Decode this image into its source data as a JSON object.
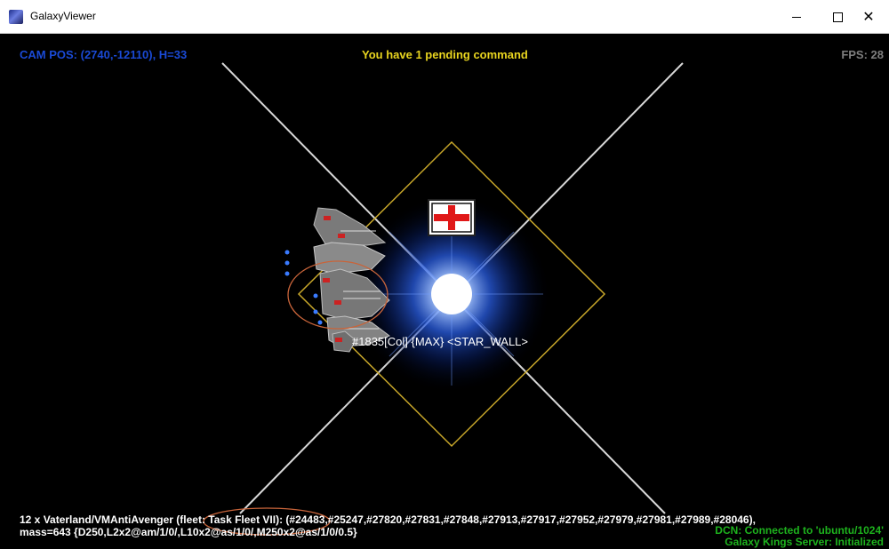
{
  "window": {
    "title": "GalaxyViewer",
    "minimize_glyph": "—",
    "maximize_glyph": "☐",
    "close_glyph": "✕"
  },
  "hud": {
    "cam_pos": "CAM POS: (2740,-12110), H=33",
    "pending": "You have 1 pending command",
    "fps": "FPS: 28"
  },
  "star": {
    "label": "#1835[Col] {MAX} <STAR_WALL>",
    "flag_icon": "red-cross-flag-icon"
  },
  "fleet_info": {
    "line1": "12 x Vaterland/VMAntiAvenger (fleet: Task Fleet VII): (#24483,#25247,#27820,#27831,#27848,#27913,#27917,#27952,#27979,#27981,#27989,#28046),",
    "line2": "mass=643 {D250,L2x2@am/1/0/,L10x2@as/1/0/,M250x2@as/1/0/0.5}"
  },
  "status": {
    "dcn": "DCN: Connected to 'ubuntu/1024'",
    "server": "Galaxy Kings Server: Initialized"
  },
  "colors": {
    "cam_pos": "#1a4ad6",
    "pending": "#e9d51f",
    "fps": "#7e7e7e",
    "status": "#1db31d",
    "diamond": "#c8a72a",
    "highlight_ellipse": "#c8643a"
  }
}
